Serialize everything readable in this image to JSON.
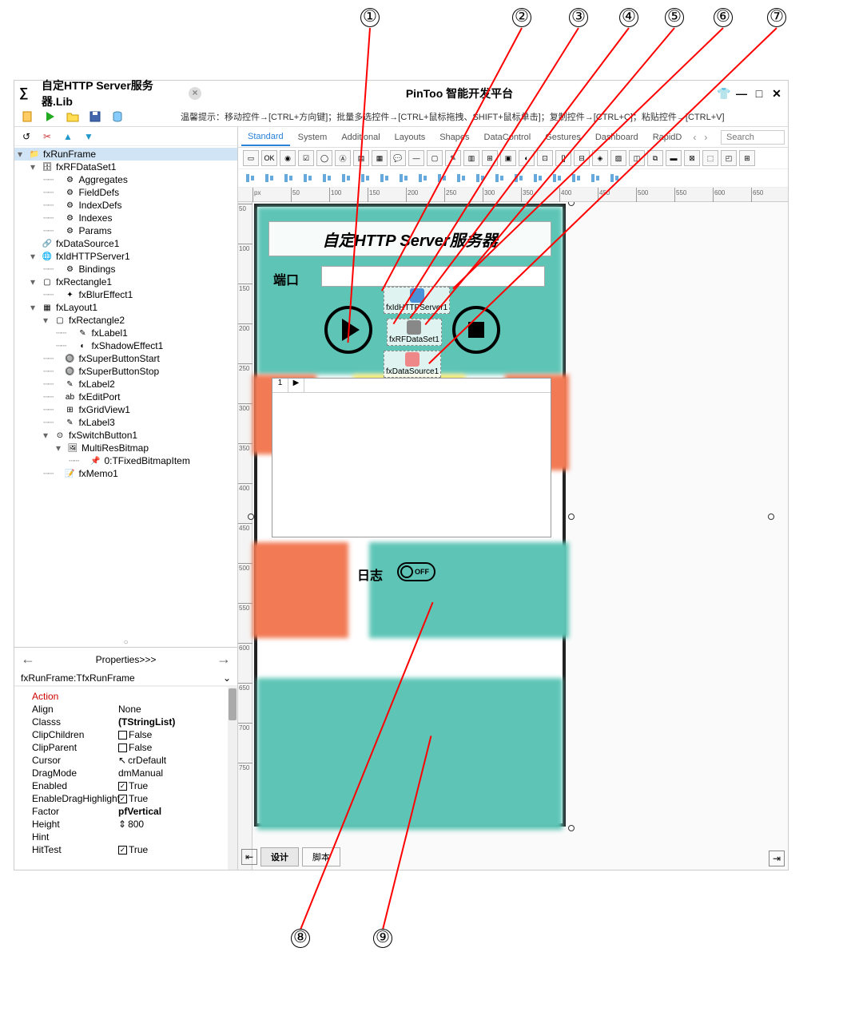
{
  "callouts": [
    "①",
    "②",
    "③",
    "④",
    "⑤",
    "⑥",
    "⑦",
    "⑧",
    "⑨"
  ],
  "title": {
    "tab": "自定HTTP Server服务器.Lib",
    "center": "PinToo 智能开发平台"
  },
  "hint": "温馨提示：移动控件→[CTRL+方向键]；批量多选控件→[CTRL+鼠标拖拽、SHIFT+鼠标单击]；复制控件→[CTRL+C]；粘贴控件→[CTRL+V]",
  "tabs": [
    "Standard",
    "System",
    "Additional",
    "Layouts",
    "Shapes",
    "DataControl",
    "Gestures",
    "Dashboard",
    "RapidD"
  ],
  "tabs_active": 0,
  "search_placeholder": "Search",
  "tree": [
    {
      "d": 0,
      "t": "▾",
      "i": "📁",
      "l": "fxRunFrame",
      "sel": true
    },
    {
      "d": 1,
      "t": "▾",
      "i": "🗄",
      "l": "fxRFDataSet1"
    },
    {
      "d": 2,
      "t": "",
      "i": "⚙",
      "l": "Aggregates",
      "dots": true
    },
    {
      "d": 2,
      "t": "",
      "i": "⚙",
      "l": "FieldDefs",
      "dots": true
    },
    {
      "d": 2,
      "t": "",
      "i": "⚙",
      "l": "IndexDefs",
      "dots": true
    },
    {
      "d": 2,
      "t": "",
      "i": "⚙",
      "l": "Indexes",
      "dots": true
    },
    {
      "d": 2,
      "t": "",
      "i": "⚙",
      "l": "Params",
      "dots": true
    },
    {
      "d": 1,
      "t": "",
      "i": "🔗",
      "l": "fxDataSource1"
    },
    {
      "d": 1,
      "t": "▾",
      "i": "🌐",
      "l": "fxIdHTTPServer1"
    },
    {
      "d": 2,
      "t": "",
      "i": "⚙",
      "l": "Bindings",
      "dots": true
    },
    {
      "d": 1,
      "t": "▾",
      "i": "▢",
      "l": "fxRectangle1"
    },
    {
      "d": 2,
      "t": "",
      "i": "✦",
      "l": "fxBlurEffect1",
      "dots": true
    },
    {
      "d": 1,
      "t": "▾",
      "i": "▦",
      "l": "fxLayout1"
    },
    {
      "d": 2,
      "t": "▾",
      "i": "▢",
      "l": "fxRectangle2"
    },
    {
      "d": 3,
      "t": "",
      "i": "✎",
      "l": "fxLabel1",
      "dots": true
    },
    {
      "d": 3,
      "t": "",
      "i": "◐",
      "l": "fxShadowEffect1",
      "dots": true
    },
    {
      "d": 2,
      "t": "",
      "i": "🔘",
      "l": "fxSuperButtonStart",
      "dots": true
    },
    {
      "d": 2,
      "t": "",
      "i": "🔘",
      "l": "fxSuperButtonStop",
      "dots": true
    },
    {
      "d": 2,
      "t": "",
      "i": "✎",
      "l": "fxLabel2",
      "dots": true
    },
    {
      "d": 2,
      "t": "",
      "i": "ab",
      "l": "fxEditPort",
      "dots": true
    },
    {
      "d": 2,
      "t": "",
      "i": "⊞",
      "l": "fxGridView1",
      "dots": true
    },
    {
      "d": 2,
      "t": "",
      "i": "✎",
      "l": "fxLabel3",
      "dots": true
    },
    {
      "d": 2,
      "t": "▾",
      "i": "⊙",
      "l": "fxSwitchButton1"
    },
    {
      "d": 3,
      "t": "▾",
      "i": "🖼",
      "l": "MultiResBitmap"
    },
    {
      "d": 4,
      "t": "",
      "i": "📌",
      "l": "0:TFixedBitmapItem",
      "dots": true
    },
    {
      "d": 2,
      "t": "",
      "i": "📝",
      "l": "fxMemo1",
      "dots": true
    }
  ],
  "prop_header": "Properties>>>",
  "prop_selector": "fxRunFrame:TfxRunFrame",
  "props": [
    {
      "n": "Action",
      "v": "",
      "cat": true
    },
    {
      "n": "Align",
      "v": "None"
    },
    {
      "n": "Classs",
      "v": "(TStringList)",
      "b": true
    },
    {
      "n": "ClipChildren",
      "v": "False",
      "chk": false
    },
    {
      "n": "ClipParent",
      "v": "False",
      "chk": false
    },
    {
      "n": "Cursor",
      "v": "crDefault",
      "ic": "↖"
    },
    {
      "n": "DragMode",
      "v": "dmManual"
    },
    {
      "n": "Enabled",
      "v": "True",
      "chk": true
    },
    {
      "n": "EnableDragHighlight",
      "v": "True",
      "chk": true
    },
    {
      "n": "Factor",
      "v": "pfVertical",
      "b": true
    },
    {
      "n": "Height",
      "v": "800",
      "ic": "⇕"
    },
    {
      "n": "Hint",
      "v": ""
    },
    {
      "n": "HitTest",
      "v": "True",
      "chk": true
    }
  ],
  "ruler_h": [
    "px",
    "50",
    "100",
    "150",
    "200",
    "250",
    "300",
    "350",
    "400",
    "450",
    "500",
    "550",
    "600",
    "650"
  ],
  "ruler_v": [
    "50",
    "100",
    "150",
    "200",
    "250",
    "300",
    "350",
    "400",
    "450",
    "500",
    "550",
    "600",
    "650",
    "700",
    "750"
  ],
  "design": {
    "title": "自定HTTP Server服务器",
    "port_label": "端口",
    "comp1": "fxIdHTTPServer1",
    "comp2": "fxRFDataSet1",
    "comp3": "fxDataSource1",
    "grid_row": "1",
    "log_label": "日志",
    "switch_text": "OFF"
  },
  "bottom_tabs": {
    "design": "设计",
    "script": "脚本"
  }
}
